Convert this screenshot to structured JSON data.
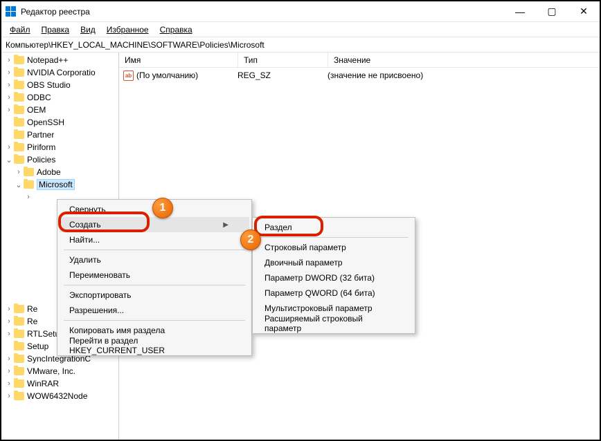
{
  "window": {
    "title": "Редактор реестра",
    "minimize": "—",
    "maximize": "▢",
    "close": "✕"
  },
  "menubar": {
    "file": "Файл",
    "edit": "Правка",
    "view": "Вид",
    "favorites": "Избранное",
    "help": "Справка"
  },
  "address": "Компьютер\\HKEY_LOCAL_MACHINE\\SOFTWARE\\Policies\\Microsoft",
  "columns": {
    "name": "Имя",
    "type": "Тип",
    "value": "Значение"
  },
  "values": {
    "default_name": "(По умолчанию)",
    "default_type": "REG_SZ",
    "default_value": "(значение не присвоено)",
    "icon_text": "ab"
  },
  "tree": {
    "notepadpp": "Notepad++",
    "nvidia": "NVIDIA Corporatio",
    "obs": "OBS Studio",
    "odbc": "ODBC",
    "oem": "OEM",
    "openssh": "OpenSSH",
    "partner": "Partner",
    "piriform": "Piriform",
    "policies": "Policies",
    "adobe": "Adobe",
    "microsoft": "Microsoft",
    "re1": "Re",
    "re2": "Re",
    "rtlsetup": "RTLSetup",
    "setup": "Setup",
    "syncint": "SyncIntegrationC",
    "vmware": "VMware, Inc.",
    "winrar": "WinRAR",
    "wow64": "WOW6432Node"
  },
  "ctx1": {
    "collapse": "Свернуть",
    "new": "Создать",
    "find": "Найти...",
    "delete": "Удалить",
    "rename": "Переименовать",
    "export": "Экспортировать",
    "permissions": "Разрешения...",
    "copyname": "Копировать имя раздела",
    "goto": "Перейти в раздел HKEY_CURRENT_USER"
  },
  "ctx2": {
    "key": "Раздел",
    "string": "Строковый параметр",
    "binary": "Двоичный параметр",
    "dword": "Параметр DWORD (32 бита)",
    "qword": "Параметр QWORD (64 бита)",
    "multistring": "Мультистроковый параметр",
    "expandstring": "Расширяемый строковый параметр"
  },
  "badges": {
    "one": "1",
    "two": "2"
  }
}
